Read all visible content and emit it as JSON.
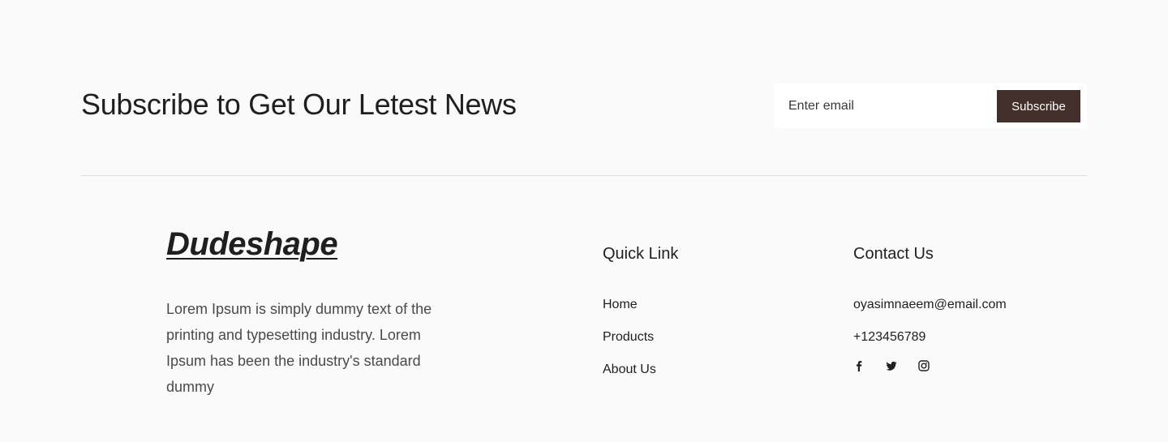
{
  "subscribe": {
    "title": "Subscribe to Get Our Letest News",
    "email_placeholder": "Enter email",
    "button_label": "Subscribe",
    "button_color": "#432f2b"
  },
  "footer": {
    "brand": "Dudeshape",
    "description": "Lorem Ipsum is simply dummy text of the printing and typesetting industry. Lorem Ipsum has been the industry's standard dummy",
    "quick_link": {
      "title": "Quick Link",
      "items": [
        {
          "label": "Home"
        },
        {
          "label": "Products"
        },
        {
          "label": "About Us"
        }
      ]
    },
    "contact": {
      "title": "Contact Us",
      "email": "oyasimnaeem@email.com",
      "phone": "+123456789",
      "social_icons": [
        "facebook-icon",
        "twitter-icon",
        "instagram-icon"
      ]
    }
  },
  "colors": {
    "background": "#fafafa",
    "text": "#1f1f1f",
    "accent": "#432f2b"
  }
}
